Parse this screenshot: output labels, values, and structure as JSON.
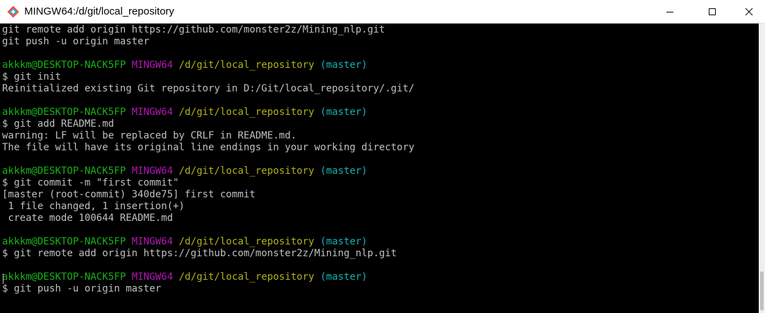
{
  "window": {
    "title": "MINGW64:/d/git/local_repository",
    "icon": "git-bash-icon",
    "controls": {
      "minimize": "minimize-icon",
      "maximize": "maximize-icon",
      "close": "close-icon"
    }
  },
  "colors": {
    "background": "#000000",
    "text": "#c0c0c0",
    "user_host": "#18b218",
    "shell": "#b218b2",
    "path": "#b2b218",
    "branch": "#18b2b2"
  },
  "terminal": {
    "lines": [
      {
        "kind": "output",
        "text": "git remote add origin https://github.com/monster2z/Mining_nlp.git"
      },
      {
        "kind": "output",
        "text": "git push -u origin master"
      },
      {
        "kind": "blank"
      },
      {
        "kind": "prompt",
        "user_host": "akkkm@DESKTOP-NACK5FP",
        "shell": "MINGW64",
        "path": "/d/git/local_repository",
        "branch": "(master)"
      },
      {
        "kind": "command",
        "text": "$ git init"
      },
      {
        "kind": "output",
        "text": "Reinitialized existing Git repository in D:/Git/local_repository/.git/"
      },
      {
        "kind": "blank"
      },
      {
        "kind": "prompt",
        "user_host": "akkkm@DESKTOP-NACK5FP",
        "shell": "MINGW64",
        "path": "/d/git/local_repository",
        "branch": "(master)"
      },
      {
        "kind": "command",
        "text": "$ git add README.md"
      },
      {
        "kind": "output",
        "text": "warning: LF will be replaced by CRLF in README.md."
      },
      {
        "kind": "output",
        "text": "The file will have its original line endings in your working directory"
      },
      {
        "kind": "blank"
      },
      {
        "kind": "prompt",
        "user_host": "akkkm@DESKTOP-NACK5FP",
        "shell": "MINGW64",
        "path": "/d/git/local_repository",
        "branch": "(master)"
      },
      {
        "kind": "command",
        "text": "$ git commit -m \"first commit\""
      },
      {
        "kind": "output",
        "text": "[master (root-commit) 340de75] first commit"
      },
      {
        "kind": "output",
        "text": " 1 file changed, 1 insertion(+)"
      },
      {
        "kind": "output",
        "text": " create mode 100644 README.md"
      },
      {
        "kind": "blank"
      },
      {
        "kind": "prompt",
        "user_host": "akkkm@DESKTOP-NACK5FP",
        "shell": "MINGW64",
        "path": "/d/git/local_repository",
        "branch": "(master)"
      },
      {
        "kind": "command",
        "text": "$ git remote add origin https://github.com/monster2z/Mining_nlp.git"
      },
      {
        "kind": "blank"
      },
      {
        "kind": "prompt",
        "user_host": "akkkm@DESKTOP-NACK5FP",
        "shell": "MINGW64",
        "path": "/d/git/local_repository",
        "branch": "(master)"
      },
      {
        "kind": "command",
        "text": "$ git push -u origin master"
      }
    ]
  }
}
